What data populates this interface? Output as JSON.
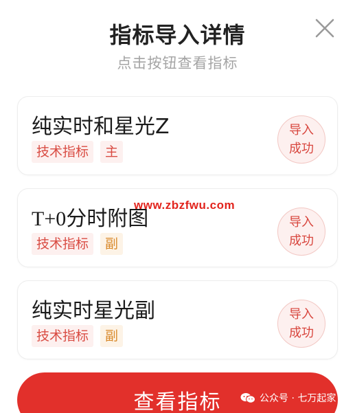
{
  "dialog": {
    "title": "指标导入详情",
    "subtitle": "点击按钮查看指标",
    "close_icon": "close-icon"
  },
  "indicators": [
    {
      "name": "纯实时和星光Z",
      "type_tag": "技术指标",
      "role_tag": "主",
      "status_line1": "导入",
      "status_line2": "成功"
    },
    {
      "name": "T+0分时附图",
      "type_tag": "技术指标",
      "role_tag": "副",
      "status_line1": "导入",
      "status_line2": "成功"
    },
    {
      "name": "纯实时星光副",
      "type_tag": "技术指标",
      "role_tag": "副",
      "status_line1": "导入",
      "status_line2": "成功"
    }
  ],
  "watermark": "www.zbzfwu.com",
  "view_button_label": "查看指标",
  "wechat_overlay": {
    "icon": "wechat-icon",
    "text": "公众号 · 七万起家"
  },
  "colors": {
    "accent": "#e2302b",
    "tag_main_text": "#d94c43",
    "tag_sub_text": "#d98a2c",
    "stamp_bg": "#fdf0ef"
  }
}
